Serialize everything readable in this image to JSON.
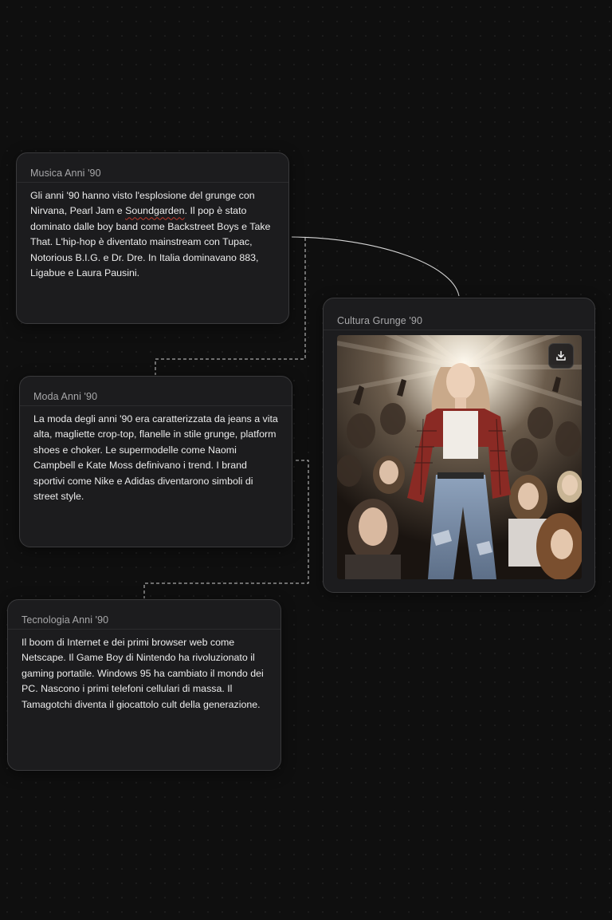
{
  "cards": {
    "musica": {
      "title": "Musica Anni '90",
      "text_before": "Gli anni '90 hanno visto l'esplosione del grunge con Nirvana, Pearl Jam e ",
      "text_flagged": "Soundgarden",
      "text_after": ". Il pop è stato dominato dalle boy band come Backstreet Boys e Take That. L'hip-hop è diventato mainstream con Tupac, Notorious B.I.G. e Dr. Dre. In Italia dominavano 883, Ligabue e Laura Pausini."
    },
    "moda": {
      "title": "Moda Anni '90",
      "text": "La moda degli anni '90 era caratterizzata da jeans a vita alta, magliette crop-top, flanelle in stile grunge, platform shoes e choker. Le supermodelle come Naomi Campbell e Kate Moss definivano i trend. I brand sportivi come Nike e Adidas diventarono simboli di street style."
    },
    "tecnologia": {
      "title": "Tecnologia Anni '90",
      "text": "Il boom di Internet e dei primi browser web come Netscape. Il Game Boy di Nintendo ha rivoluzionato il gaming portatile. Windows 95 ha cambiato il mondo dei PC. Nascono i primi telefoni cellulari di massa. Il Tamagotchi diventa il giocattolo cult della generazione."
    },
    "grunge": {
      "title": "Cultura Grunge '90",
      "download_icon": "download-icon"
    }
  },
  "colors": {
    "background": "#0f0f0f",
    "card": "#1c1c1e",
    "border": "#3a3a3c",
    "connector": "#cfcfcf"
  }
}
